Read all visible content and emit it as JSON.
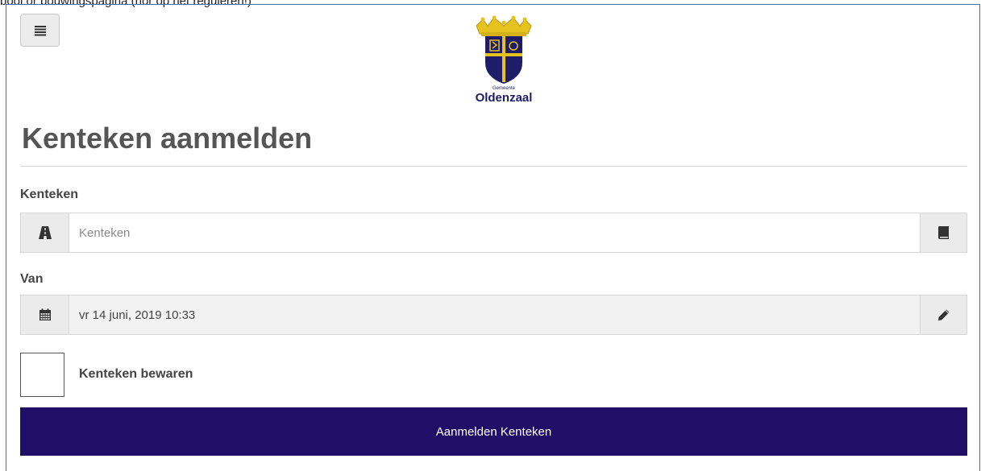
{
  "page": {
    "cutoff_text": "bool or bouwingspagina (hor op het reguleren!)",
    "menu_icon": "hamburger-menu-icon",
    "logo": {
      "small_text": "Gemeente",
      "name": "Oldenzaal"
    },
    "title": "Kenteken aanmelden"
  },
  "form": {
    "kenteken": {
      "label": "Kenteken",
      "placeholder": "Kenteken",
      "value": "",
      "left_icon": "road-icon",
      "right_icon": "book-icon"
    },
    "van": {
      "label": "Van",
      "value": "vr 14 juni, 2019 10:33",
      "left_icon": "calendar-icon",
      "right_icon": "pencil-icon"
    },
    "bewaren": {
      "label": "Kenteken bewaren",
      "checked": false
    },
    "submit_label": "Aanmelden Kenteken"
  },
  "colors": {
    "primary": "#1f0f66",
    "addon_bg": "#ebebeb",
    "logo_blue": "#1f1c69",
    "logo_gold": "#e5c21e"
  }
}
